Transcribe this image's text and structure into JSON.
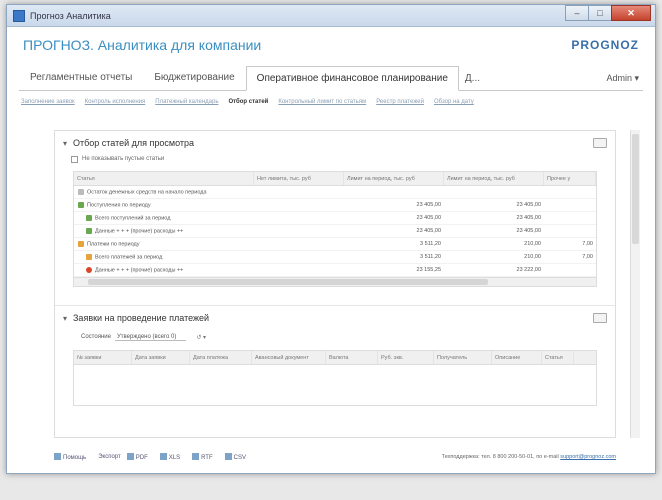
{
  "window": {
    "title": "Прогноз Аналитика"
  },
  "header": {
    "app_title": "ПРОГНОЗ. Аналитика для компании",
    "brand": "PROGNOZ"
  },
  "tabs": [
    {
      "label": "Регламентные отчеты"
    },
    {
      "label": "Бюджетирование"
    },
    {
      "label": "Оперативное финансовое планирование"
    }
  ],
  "tab_more": "Д...",
  "user_dropdown": "Admin",
  "subtabs": [
    {
      "label": "Заполнение заявок"
    },
    {
      "label": "Контроль исполнения"
    },
    {
      "label": "Платежный календарь"
    },
    {
      "label": "Отбор статей"
    },
    {
      "label": "Контрольный лимит по статьям"
    },
    {
      "label": "Реестр платежей"
    },
    {
      "label": "Обзор на дату"
    }
  ],
  "panel1": {
    "title": "Отбор статей для просмотра",
    "checkbox_label": "Не показывать пустые статьи",
    "columns": [
      "Статья",
      "Нет лимита, тыс. руб",
      "Лимит на период, тыс. руб",
      "Лимит на период, тыс. руб",
      "Прочее у"
    ],
    "rows": [
      {
        "label": "Остаток денежных средств на начало периода",
        "icon": "neutral",
        "indent": 0,
        "c1": "",
        "c2": "",
        "c3": "",
        "c4": ""
      },
      {
        "label": "Поступления по периоду",
        "icon": "green",
        "indent": 0,
        "c1": "",
        "c2": "23 405,00",
        "c3": "23 405,00",
        "c4": ""
      },
      {
        "label": "Всего поступлений за период",
        "icon": "green",
        "indent": 1,
        "c1": "",
        "c2": "23 405,00",
        "c3": "23 405,00",
        "c4": ""
      },
      {
        "label": "Данные + + + (прочие) расходы ++",
        "icon": "green",
        "indent": 1,
        "c1": "",
        "c2": "23 405,00",
        "c3": "23 405,00",
        "c4": ""
      },
      {
        "label": "Платежи по периоду",
        "icon": "orange",
        "indent": 0,
        "c1": "",
        "c2": "3 511,20",
        "c3": "210,00",
        "c4": "7,00"
      },
      {
        "label": "Всего платежей за период",
        "icon": "orange",
        "indent": 1,
        "c1": "",
        "c2": "3 511,20",
        "c3": "210,00",
        "c4": "7,00"
      },
      {
        "label": "Данные + + + (прочие) расходы ++",
        "icon": "red",
        "indent": 1,
        "c1": "",
        "c2": "23 155,25",
        "c3": "23 222,00",
        "c4": ""
      }
    ]
  },
  "panel2": {
    "title": "Заявки на проведение платежей",
    "filter_label": "Состояние",
    "filter_value": "Утверждено (всего 0)",
    "columns": [
      "№ заявки",
      "Дата заявки",
      "Дата платежа",
      "Авансовый документ",
      "Валюта",
      "Руб. экв.",
      "Получатель",
      "Описание",
      "Статья"
    ]
  },
  "footer": {
    "help": "Помощь",
    "export_label": "Экспорт",
    "exports": [
      "PDF",
      "XLS",
      "RTF",
      "CSV"
    ],
    "support_text": "Техподдержка: тел. 8 800 200-50-01, по e-mail",
    "support_email": "support@prognoz.com"
  },
  "colors": {
    "accent": "#3a8fc2",
    "green": "#6aa84f",
    "orange": "#e6a23c",
    "red": "#d9472b"
  }
}
